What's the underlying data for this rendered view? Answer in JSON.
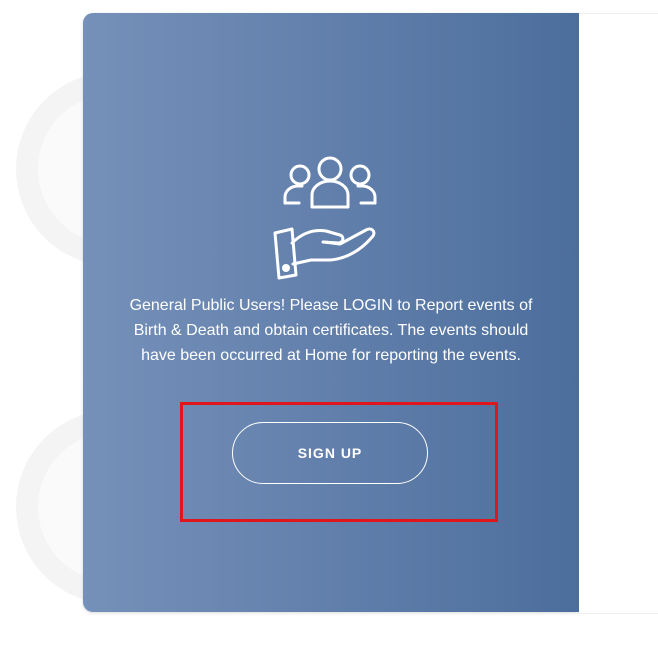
{
  "colors": {
    "card_gradient_start": "#7591ba",
    "card_gradient_end": "#4c6e9c",
    "text": "#ffffff",
    "highlight": "#e0161d"
  },
  "card": {
    "icon": "people-in-hand-icon",
    "message": "General Public Users! Please LOGIN to Report events of Birth & Death and obtain certificates. The events should have been occurred at Home for reporting the events.",
    "signup_label": "SIGN UP"
  }
}
